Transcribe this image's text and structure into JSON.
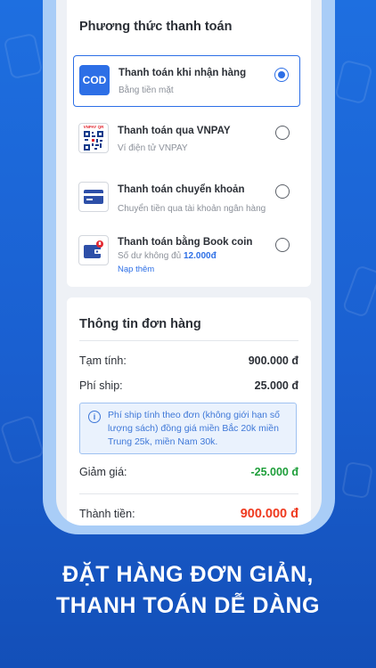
{
  "payment": {
    "section_title": "Phương thức thanh toán",
    "options": [
      {
        "title": "Thanh toán khi nhận hàng",
        "subtitle": "Bằng tiền mặt",
        "icon": "cod-icon",
        "icon_text": "COD",
        "selected": true
      },
      {
        "title": "Thanh toán qua VNPAY",
        "subtitle": "Ví điện tử VNPAY",
        "icon": "vnpay-qr-icon",
        "icon_text": "VNPAY QR",
        "selected": false
      },
      {
        "title": "Thanh toán chuyển khoản",
        "subtitle": "Chuyển tiền qua tài khoản ngân hàng",
        "icon": "bank-card-icon",
        "selected": false
      },
      {
        "title": "Thanh toán bằng Book coin",
        "subtitle": "Số dư không đủ",
        "balance": "12.000đ",
        "link": "Nạp thêm",
        "icon": "wallet-icon",
        "selected": false
      }
    ]
  },
  "order": {
    "section_title": "Thông tin đơn hàng",
    "subtotal_label": "Tạm tính:",
    "subtotal_value": "900.000 đ",
    "ship_label": "Phí ship:",
    "ship_value": "25.000 đ",
    "ship_note": "Phí ship tính theo đơn (không giới hạn số lượng sách) đồng giá miền Bắc 20k miền Trung 25k, miền Nam 30k.",
    "discount_label": "Giảm giá:",
    "discount_value": "-25.000 đ",
    "total_label": "Thành tiền:",
    "total_value": "900.000 đ"
  },
  "headline": {
    "line1": "ĐẶT HÀNG ĐƠN GIẢN,",
    "line2": "THANH TOÁN DỄ DÀNG"
  },
  "colors": {
    "accent": "#2d6fe6",
    "discount": "#1e9e3a",
    "total": "#ef3a1f",
    "background": "#1e6fe0"
  }
}
